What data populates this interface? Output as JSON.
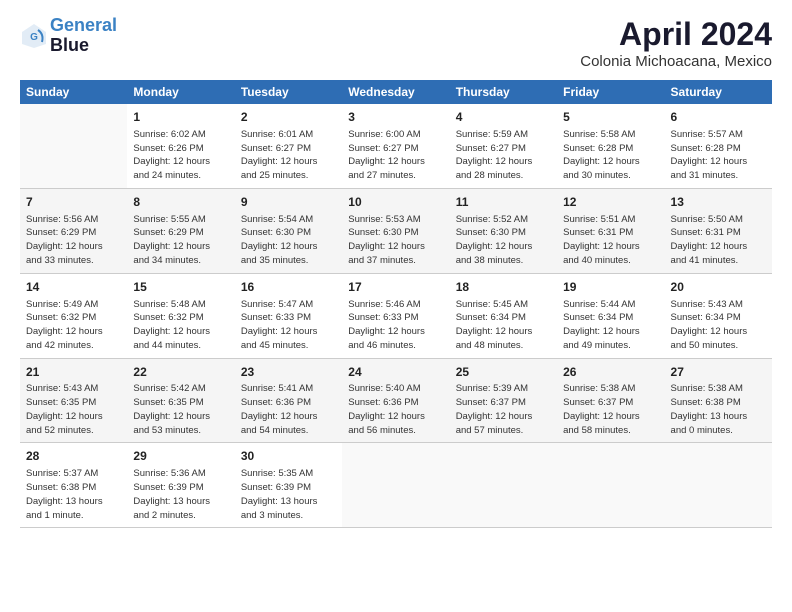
{
  "header": {
    "logo_line1": "General",
    "logo_line2": "Blue",
    "month": "April 2024",
    "location": "Colonia Michoacana, Mexico"
  },
  "days_of_week": [
    "Sunday",
    "Monday",
    "Tuesday",
    "Wednesday",
    "Thursday",
    "Friday",
    "Saturday"
  ],
  "weeks": [
    [
      {
        "day": "",
        "info": ""
      },
      {
        "day": "1",
        "info": "Sunrise: 6:02 AM\nSunset: 6:26 PM\nDaylight: 12 hours\nand 24 minutes."
      },
      {
        "day": "2",
        "info": "Sunrise: 6:01 AM\nSunset: 6:27 PM\nDaylight: 12 hours\nand 25 minutes."
      },
      {
        "day": "3",
        "info": "Sunrise: 6:00 AM\nSunset: 6:27 PM\nDaylight: 12 hours\nand 27 minutes."
      },
      {
        "day": "4",
        "info": "Sunrise: 5:59 AM\nSunset: 6:27 PM\nDaylight: 12 hours\nand 28 minutes."
      },
      {
        "day": "5",
        "info": "Sunrise: 5:58 AM\nSunset: 6:28 PM\nDaylight: 12 hours\nand 30 minutes."
      },
      {
        "day": "6",
        "info": "Sunrise: 5:57 AM\nSunset: 6:28 PM\nDaylight: 12 hours\nand 31 minutes."
      }
    ],
    [
      {
        "day": "7",
        "info": "Sunrise: 5:56 AM\nSunset: 6:29 PM\nDaylight: 12 hours\nand 33 minutes."
      },
      {
        "day": "8",
        "info": "Sunrise: 5:55 AM\nSunset: 6:29 PM\nDaylight: 12 hours\nand 34 minutes."
      },
      {
        "day": "9",
        "info": "Sunrise: 5:54 AM\nSunset: 6:30 PM\nDaylight: 12 hours\nand 35 minutes."
      },
      {
        "day": "10",
        "info": "Sunrise: 5:53 AM\nSunset: 6:30 PM\nDaylight: 12 hours\nand 37 minutes."
      },
      {
        "day": "11",
        "info": "Sunrise: 5:52 AM\nSunset: 6:30 PM\nDaylight: 12 hours\nand 38 minutes."
      },
      {
        "day": "12",
        "info": "Sunrise: 5:51 AM\nSunset: 6:31 PM\nDaylight: 12 hours\nand 40 minutes."
      },
      {
        "day": "13",
        "info": "Sunrise: 5:50 AM\nSunset: 6:31 PM\nDaylight: 12 hours\nand 41 minutes."
      }
    ],
    [
      {
        "day": "14",
        "info": "Sunrise: 5:49 AM\nSunset: 6:32 PM\nDaylight: 12 hours\nand 42 minutes."
      },
      {
        "day": "15",
        "info": "Sunrise: 5:48 AM\nSunset: 6:32 PM\nDaylight: 12 hours\nand 44 minutes."
      },
      {
        "day": "16",
        "info": "Sunrise: 5:47 AM\nSunset: 6:33 PM\nDaylight: 12 hours\nand 45 minutes."
      },
      {
        "day": "17",
        "info": "Sunrise: 5:46 AM\nSunset: 6:33 PM\nDaylight: 12 hours\nand 46 minutes."
      },
      {
        "day": "18",
        "info": "Sunrise: 5:45 AM\nSunset: 6:34 PM\nDaylight: 12 hours\nand 48 minutes."
      },
      {
        "day": "19",
        "info": "Sunrise: 5:44 AM\nSunset: 6:34 PM\nDaylight: 12 hours\nand 49 minutes."
      },
      {
        "day": "20",
        "info": "Sunrise: 5:43 AM\nSunset: 6:34 PM\nDaylight: 12 hours\nand 50 minutes."
      }
    ],
    [
      {
        "day": "21",
        "info": "Sunrise: 5:43 AM\nSunset: 6:35 PM\nDaylight: 12 hours\nand 52 minutes."
      },
      {
        "day": "22",
        "info": "Sunrise: 5:42 AM\nSunset: 6:35 PM\nDaylight: 12 hours\nand 53 minutes."
      },
      {
        "day": "23",
        "info": "Sunrise: 5:41 AM\nSunset: 6:36 PM\nDaylight: 12 hours\nand 54 minutes."
      },
      {
        "day": "24",
        "info": "Sunrise: 5:40 AM\nSunset: 6:36 PM\nDaylight: 12 hours\nand 56 minutes."
      },
      {
        "day": "25",
        "info": "Sunrise: 5:39 AM\nSunset: 6:37 PM\nDaylight: 12 hours\nand 57 minutes."
      },
      {
        "day": "26",
        "info": "Sunrise: 5:38 AM\nSunset: 6:37 PM\nDaylight: 12 hours\nand 58 minutes."
      },
      {
        "day": "27",
        "info": "Sunrise: 5:38 AM\nSunset: 6:38 PM\nDaylight: 13 hours\nand 0 minutes."
      }
    ],
    [
      {
        "day": "28",
        "info": "Sunrise: 5:37 AM\nSunset: 6:38 PM\nDaylight: 13 hours\nand 1 minute."
      },
      {
        "day": "29",
        "info": "Sunrise: 5:36 AM\nSunset: 6:39 PM\nDaylight: 13 hours\nand 2 minutes."
      },
      {
        "day": "30",
        "info": "Sunrise: 5:35 AM\nSunset: 6:39 PM\nDaylight: 13 hours\nand 3 minutes."
      },
      {
        "day": "",
        "info": ""
      },
      {
        "day": "",
        "info": ""
      },
      {
        "day": "",
        "info": ""
      },
      {
        "day": "",
        "info": ""
      }
    ]
  ]
}
